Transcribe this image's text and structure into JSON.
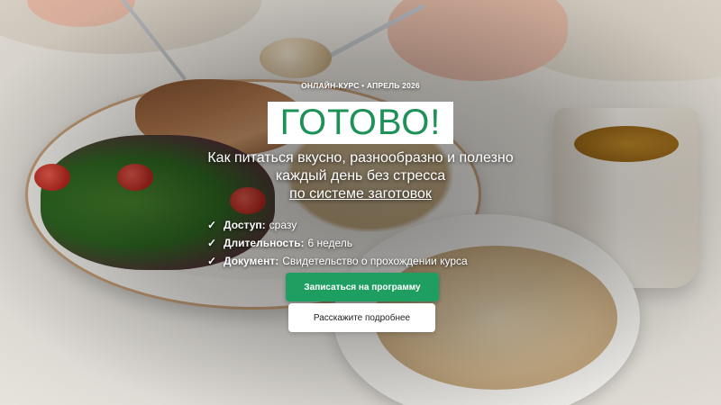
{
  "hero": {
    "eyebrow": "ОНЛАЙН-КУРС • АПРЕЛЬ 2026",
    "title": "ГОТОВО!",
    "subtitle_line1": "Как питаться вкусно, разнообразно и полезно",
    "subtitle_line2": "каждый день без стресса",
    "subtitle_link": "по системе заготовок"
  },
  "features": [
    {
      "icon": "check-icon",
      "label": "Доступ:",
      "value": "сразу"
    },
    {
      "icon": "check-icon",
      "label": "Длительность:",
      "value": "6 недель"
    },
    {
      "icon": "check-icon",
      "label": "Документ:",
      "value": "Свидетельство о прохождении курса"
    }
  ],
  "buttons": {
    "primary_label": "Записаться на программу",
    "secondary_label": "Расскажите подробнее"
  },
  "colors": {
    "accent": "#1e9e60",
    "title_text": "#1e9157",
    "title_box": "#ffffff"
  }
}
